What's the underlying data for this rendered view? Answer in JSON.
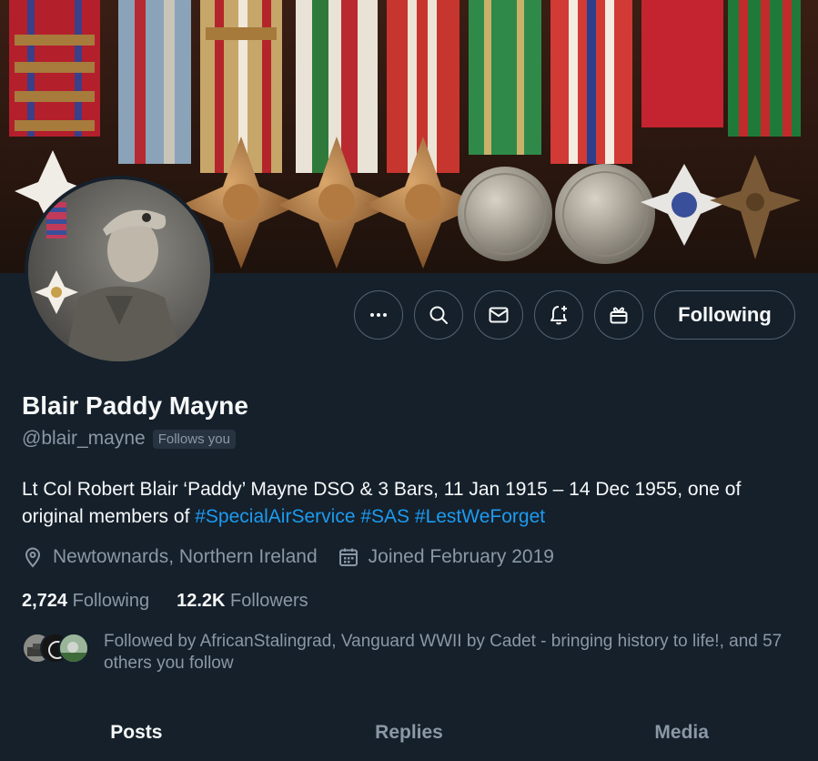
{
  "profile": {
    "name": "Blair Paddy Mayne",
    "handle": "@blair_mayne",
    "follows_you_badge": "Follows you",
    "bio_text": "Lt Col Robert Blair ‘Paddy’ Mayne DSO & 3 Bars, 11 Jan 1915 – 14 Dec 1955, one of original members of ",
    "bio_hashtags": [
      "#SpecialAirService",
      "#SAS",
      "#LestWeForget"
    ],
    "location": "Newtownards, Northern Ireland",
    "joined": "Joined February 2019",
    "following_count": "2,724",
    "following_label": "Following",
    "followers_count": "12.2K",
    "followers_label": "Followers",
    "followed_by_text": "Followed by AfricanStalingrad, Vanguard WWII by Cadet - bringing history to life!, and 57 others you follow"
  },
  "actions": {
    "more_icon": "more-icon",
    "search_icon": "search-icon",
    "message_icon": "mail-icon",
    "notify_icon": "bell-plus-icon",
    "gift_icon": "gift-icon",
    "follow_label": "Following"
  },
  "tabs": [
    {
      "label": "Posts",
      "active": true
    },
    {
      "label": "Replies",
      "active": false
    },
    {
      "label": "Media",
      "active": false
    }
  ],
  "colors": {
    "background": "#15202b",
    "accent": "#1d9bf0",
    "muted": "#8b98a5",
    "border": "#536471"
  }
}
